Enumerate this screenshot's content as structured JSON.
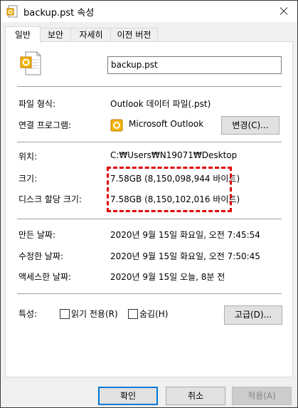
{
  "window": {
    "title": "backup.pst 속성"
  },
  "tabs": [
    {
      "label": "일반",
      "active": true
    },
    {
      "label": "보안",
      "active": false
    },
    {
      "label": "자세히",
      "active": false
    },
    {
      "label": "이전 버전",
      "active": false
    }
  ],
  "general": {
    "file_name": "backup.pst",
    "file_type_label": "파일 형식:",
    "file_type_value": "Outlook 데이터 파일(.pst)",
    "opens_with_label": "연결 프로그램:",
    "opens_with_value": "Microsoft Outlook",
    "change_button": "변경(C)...",
    "location_label": "위치:",
    "location_value": "C:₩Users₩N19071₩Desktop",
    "size_label": "크기:",
    "size_value": "7.58GB (8,150,098,944 바이트)",
    "size_on_disk_label": "디스크 할당 크기:",
    "size_on_disk_value": "7.58GB (8,150,102,016 바이트)",
    "created_label": "만든 날짜:",
    "created_value": "2020년 9월 15일 화요일, 오전 7:45:54",
    "modified_label": "수정한 날짜:",
    "modified_value": "2020년 9월 15일 화요일, 오전 7:50:45",
    "accessed_label": "액세스한 날짜:",
    "accessed_value": "2020년 9월 15일 오늘, 8분 전",
    "attributes_label": "특성:",
    "readonly_label": "읽기 전용(R)",
    "hidden_label": "숨김(H)",
    "advanced_button": "고급(D)..."
  },
  "footer": {
    "ok_button": "확인",
    "cancel_button": "취소",
    "apply_button": "적용(A)"
  },
  "colors": {
    "highlight": "#e00000",
    "accent": "#0078d7"
  }
}
